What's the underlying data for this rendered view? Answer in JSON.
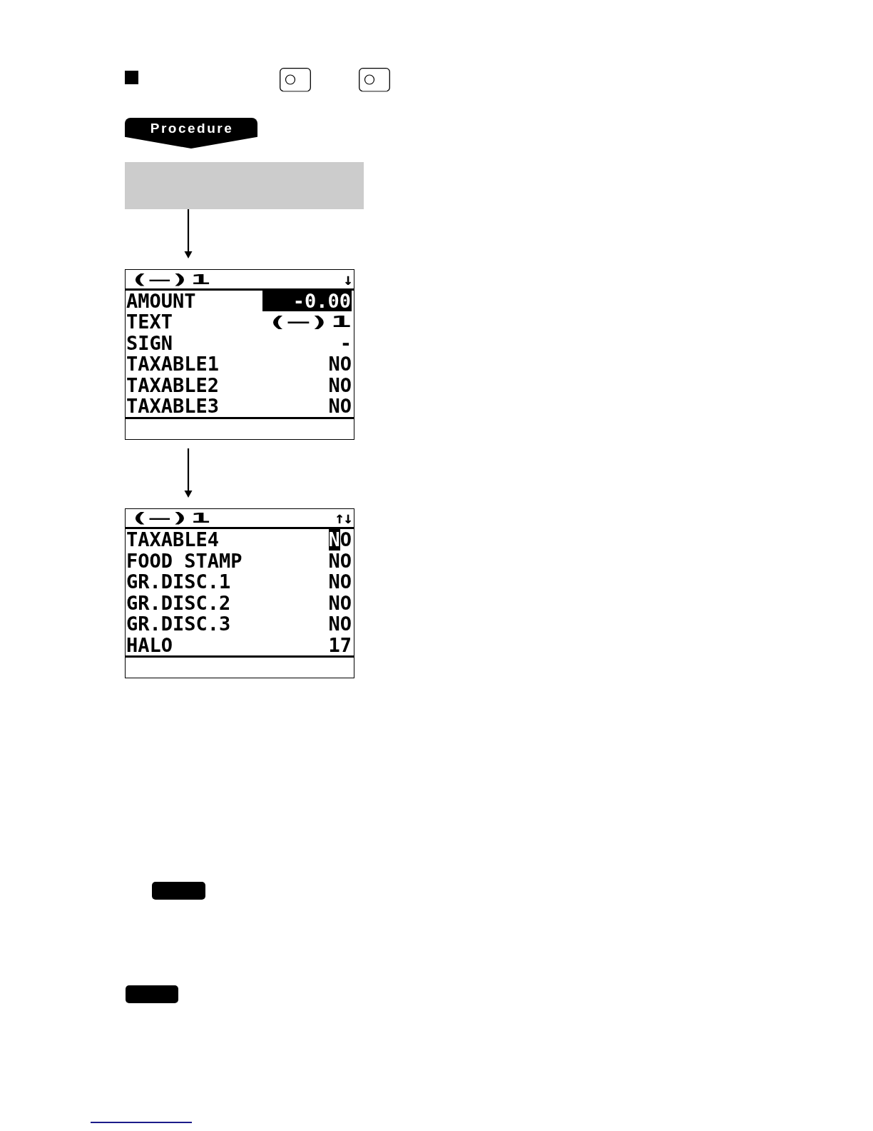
{
  "procedure_label": "Procedure",
  "screens": [
    {
      "title": "(—)1",
      "scroll_indicator": "↓",
      "field_highlight": true,
      "rows": [
        {
          "label": "AMOUNT",
          "value": "-0.00",
          "selected": true,
          "double_width": false
        },
        {
          "label": "TEXT",
          "value": "(—)1",
          "selected": false,
          "double_width": true
        },
        {
          "label": "SIGN",
          "value": "-",
          "selected": false,
          "double_width": false
        },
        {
          "label": "TAXABLE1",
          "value": "NO",
          "selected": false,
          "double_width": false
        },
        {
          "label": "TAXABLE2",
          "value": "NO",
          "selected": false,
          "double_width": false
        },
        {
          "label": "TAXABLE3",
          "value": "NO",
          "selected": false,
          "double_width": false
        }
      ]
    },
    {
      "title": "(—)1",
      "scroll_indicator": "↑↓",
      "field_highlight": false,
      "rows": [
        {
          "label": "TAXABLE4",
          "value": "NO",
          "selected": true,
          "double_width": false
        },
        {
          "label": "FOOD STAMP",
          "value": "NO",
          "selected": false,
          "double_width": false
        },
        {
          "label": "GR.DISC.1",
          "value": "NO",
          "selected": false,
          "double_width": false
        },
        {
          "label": "GR.DISC.2",
          "value": "NO",
          "selected": false,
          "double_width": false
        },
        {
          "label": "GR.DISC.3",
          "value": "NO",
          "selected": false,
          "double_width": false
        },
        {
          "label": "HALO",
          "value": "17",
          "selected": false,
          "double_width": false
        }
      ]
    }
  ]
}
